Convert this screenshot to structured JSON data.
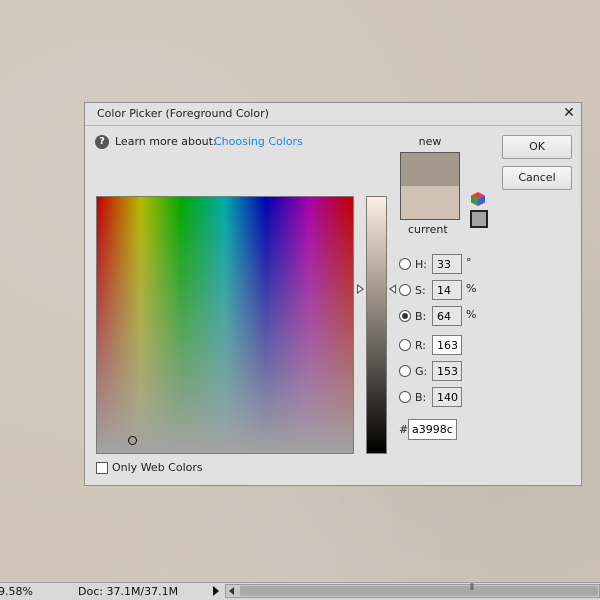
{
  "dialog": {
    "title": "Color Picker (Foreground Color)",
    "close_label": "✕",
    "help_icon": "?",
    "help_text": "Learn more about:",
    "help_link": "Choosing Colors",
    "new_label": "new",
    "current_label": "current",
    "ok_label": "OK",
    "cancel_label": "Cancel",
    "only_web_colors_label": "Only Web Colors",
    "only_web_colors_checked": false,
    "colors": {
      "new": "#a3998c",
      "current": "#cfc2b4",
      "link": "#1a86e8"
    },
    "fields": [
      {
        "key": "H",
        "label": "H:",
        "value": "33",
        "unit": "°",
        "checked": false,
        "active": false
      },
      {
        "key": "S",
        "label": "S:",
        "value": "14",
        "unit": "%",
        "checked": false,
        "active": false
      },
      {
        "key": "B",
        "label": "B:",
        "value": "64",
        "unit": "%",
        "checked": true,
        "active": false
      },
      {
        "key": "R",
        "label": "R:",
        "value": "163",
        "unit": "",
        "checked": false,
        "active": true
      },
      {
        "key": "G",
        "label": "G:",
        "value": "153",
        "unit": "",
        "checked": false,
        "active": false
      },
      {
        "key": "Bl",
        "label": "B:",
        "value": "140",
        "unit": "",
        "checked": false,
        "active": false
      }
    ],
    "hex_label": "#",
    "hex_value": "a3998c"
  },
  "status": {
    "zoom": "9.58%",
    "doc": "Doc: 37.1M/37.1M",
    "grip": "⦀"
  }
}
